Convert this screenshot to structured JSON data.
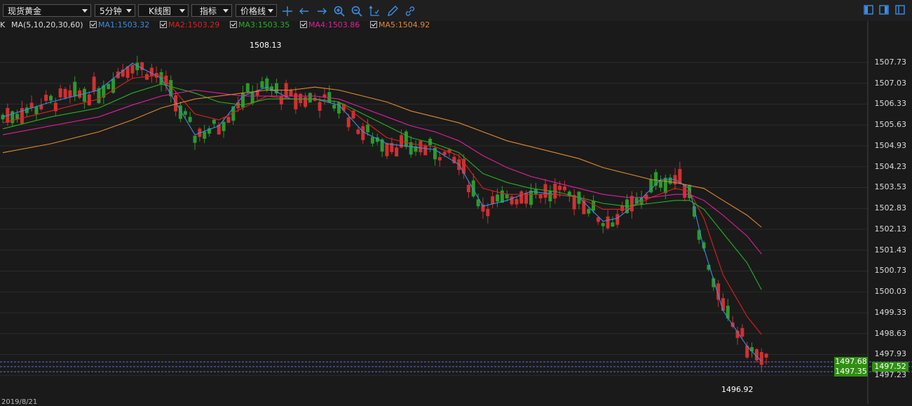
{
  "toolbar": {
    "symbol": "现货黄金",
    "period": "5分钟",
    "chart_kind": "K线图",
    "indicator": "指标",
    "line_type": "价格线",
    "tools": [
      "crosshair-icon",
      "arrow-left-icon",
      "arrow-right-icon",
      "zoom-in-icon",
      "zoom-out-icon",
      "axis-icon",
      "pencil-icon",
      "link-icon"
    ]
  },
  "legend": {
    "prefix": "K",
    "ma_title": "MA(5,10,20,30,60)",
    "items": [
      {
        "label": "MA1:1503.32",
        "color": "#3a8ee6"
      },
      {
        "label": "MA2:1503.29",
        "color": "#e02020"
      },
      {
        "label": "MA3:1503.35",
        "color": "#22b422"
      },
      {
        "label": "MA4:1503.86",
        "color": "#e020a0"
      },
      {
        "label": "MA5:1504.92",
        "color": "#e08a30"
      }
    ]
  },
  "colors": {
    "up": "#2a9a2a",
    "down": "#d23030",
    "grid": "#2b2b2b",
    "bg": "#1a1a1a"
  },
  "chart_data": {
    "type": "candlestick",
    "y_ticks": [
      "1507.73",
      "1507.03",
      "1506.33",
      "1505.63",
      "1504.93",
      "1504.23",
      "1503.53",
      "1502.83",
      "1502.13",
      "1501.43",
      "1500.73",
      "1500.03",
      "1499.33",
      "1498.63",
      "1497.93",
      "1497.23"
    ],
    "ylim": [
      1496.6,
      1508.6
    ],
    "annotations": [
      {
        "label": "1508.13",
        "value": 1508.13,
        "kind": "high"
      },
      {
        "label": "1496.92",
        "value": 1496.92,
        "kind": "low"
      }
    ],
    "price_badges": [
      {
        "label": "1497.68",
        "value": 1497.68
      },
      {
        "label": "1497.52",
        "value": 1497.52
      },
      {
        "label": "1497.35",
        "value": 1497.35
      }
    ],
    "bar_count": 160,
    "series_ma": [
      {
        "name": "MA1",
        "color": "#3a8ee6",
        "points": [
          [
            0,
            1505.9
          ],
          [
            10,
            1506.4
          ],
          [
            20,
            1506.8
          ],
          [
            27,
            1507.7
          ],
          [
            33,
            1507.2
          ],
          [
            40,
            1505.3
          ],
          [
            45,
            1505.6
          ],
          [
            50,
            1506.6
          ],
          [
            55,
            1506.9
          ],
          [
            60,
            1506.5
          ],
          [
            65,
            1506.5
          ],
          [
            70,
            1506.3
          ],
          [
            75,
            1505.4
          ],
          [
            80,
            1505.0
          ],
          [
            85,
            1504.9
          ],
          [
            90,
            1504.8
          ],
          [
            95,
            1504.3
          ],
          [
            100,
            1502.9
          ],
          [
            105,
            1503.1
          ],
          [
            110,
            1503.4
          ],
          [
            115,
            1503.3
          ],
          [
            120,
            1503.2
          ],
          [
            125,
            1502.4
          ],
          [
            128,
            1502.5
          ],
          [
            132,
            1503.0
          ],
          [
            137,
            1503.8
          ],
          [
            140,
            1503.8
          ],
          [
            143,
            1503.5
          ],
          [
            146,
            1501.5
          ],
          [
            150,
            1499.4
          ],
          [
            155,
            1498.2
          ],
          [
            158,
            1497.7
          ]
        ]
      },
      {
        "name": "MA2",
        "color": "#e02020",
        "points": [
          [
            0,
            1505.7
          ],
          [
            10,
            1506.1
          ],
          [
            20,
            1506.5
          ],
          [
            27,
            1507.2
          ],
          [
            33,
            1507.3
          ],
          [
            40,
            1506.0
          ],
          [
            45,
            1505.8
          ],
          [
            50,
            1506.2
          ],
          [
            55,
            1506.6
          ],
          [
            60,
            1506.5
          ],
          [
            65,
            1506.5
          ],
          [
            70,
            1506.4
          ],
          [
            75,
            1505.8
          ],
          [
            80,
            1505.2
          ],
          [
            85,
            1505.0
          ],
          [
            90,
            1504.9
          ],
          [
            95,
            1504.6
          ],
          [
            100,
            1503.5
          ],
          [
            105,
            1503.3
          ],
          [
            110,
            1503.3
          ],
          [
            115,
            1503.3
          ],
          [
            120,
            1503.2
          ],
          [
            125,
            1502.8
          ],
          [
            130,
            1502.8
          ],
          [
            135,
            1503.2
          ],
          [
            140,
            1503.5
          ],
          [
            143,
            1503.4
          ],
          [
            146,
            1502.5
          ],
          [
            150,
            1500.6
          ],
          [
            155,
            1499.2
          ],
          [
            158,
            1498.6
          ]
        ]
      },
      {
        "name": "MA3",
        "color": "#22b422",
        "points": [
          [
            0,
            1505.5
          ],
          [
            10,
            1505.9
          ],
          [
            20,
            1506.2
          ],
          [
            27,
            1506.7
          ],
          [
            33,
            1507.0
          ],
          [
            40,
            1506.7
          ],
          [
            45,
            1506.4
          ],
          [
            50,
            1506.3
          ],
          [
            55,
            1506.5
          ],
          [
            60,
            1506.5
          ],
          [
            65,
            1506.5
          ],
          [
            70,
            1506.4
          ],
          [
            75,
            1506.0
          ],
          [
            80,
            1505.6
          ],
          [
            85,
            1505.2
          ],
          [
            90,
            1505.0
          ],
          [
            95,
            1504.7
          ],
          [
            100,
            1504.0
          ],
          [
            105,
            1503.7
          ],
          [
            110,
            1503.5
          ],
          [
            115,
            1503.4
          ],
          [
            120,
            1503.2
          ],
          [
            125,
            1503.0
          ],
          [
            130,
            1502.9
          ],
          [
            135,
            1503.0
          ],
          [
            140,
            1503.1
          ],
          [
            143,
            1503.1
          ],
          [
            146,
            1502.8
          ],
          [
            150,
            1502.0
          ],
          [
            155,
            1501.0
          ],
          [
            158,
            1500.1
          ]
        ]
      },
      {
        "name": "MA4",
        "color": "#e020a0",
        "points": [
          [
            0,
            1505.3
          ],
          [
            10,
            1505.6
          ],
          [
            20,
            1505.9
          ],
          [
            27,
            1506.3
          ],
          [
            33,
            1506.6
          ],
          [
            40,
            1506.8
          ],
          [
            45,
            1506.7
          ],
          [
            50,
            1506.6
          ],
          [
            55,
            1506.6
          ],
          [
            60,
            1506.6
          ],
          [
            65,
            1506.6
          ],
          [
            70,
            1506.5
          ],
          [
            75,
            1506.2
          ],
          [
            80,
            1505.9
          ],
          [
            85,
            1505.6
          ],
          [
            90,
            1505.4
          ],
          [
            95,
            1505.1
          ],
          [
            100,
            1504.6
          ],
          [
            105,
            1504.2
          ],
          [
            110,
            1503.9
          ],
          [
            115,
            1503.7
          ],
          [
            120,
            1503.5
          ],
          [
            125,
            1503.3
          ],
          [
            130,
            1503.2
          ],
          [
            135,
            1503.2
          ],
          [
            140,
            1503.3
          ],
          [
            143,
            1503.3
          ],
          [
            146,
            1503.1
          ],
          [
            150,
            1502.6
          ],
          [
            155,
            1501.9
          ],
          [
            158,
            1501.3
          ]
        ]
      },
      {
        "name": "MA5",
        "color": "#e08a30",
        "points": [
          [
            0,
            1504.7
          ],
          [
            10,
            1505.0
          ],
          [
            20,
            1505.4
          ],
          [
            27,
            1505.8
          ],
          [
            33,
            1506.2
          ],
          [
            40,
            1506.5
          ],
          [
            45,
            1506.6
          ],
          [
            50,
            1506.7
          ],
          [
            55,
            1506.8
          ],
          [
            60,
            1506.8
          ],
          [
            65,
            1506.9
          ],
          [
            70,
            1506.8
          ],
          [
            75,
            1506.6
          ],
          [
            80,
            1506.4
          ],
          [
            85,
            1506.1
          ],
          [
            90,
            1505.9
          ],
          [
            95,
            1505.7
          ],
          [
            100,
            1505.4
          ],
          [
            105,
            1505.1
          ],
          [
            110,
            1504.9
          ],
          [
            115,
            1504.7
          ],
          [
            120,
            1504.5
          ],
          [
            125,
            1504.2
          ],
          [
            130,
            1504.0
          ],
          [
            135,
            1503.8
          ],
          [
            140,
            1503.7
          ],
          [
            143,
            1503.6
          ],
          [
            146,
            1503.5
          ],
          [
            150,
            1503.1
          ],
          [
            155,
            1502.6
          ],
          [
            158,
            1502.2
          ]
        ]
      }
    ]
  },
  "footer": {
    "date_partial": "2019/8/21"
  }
}
